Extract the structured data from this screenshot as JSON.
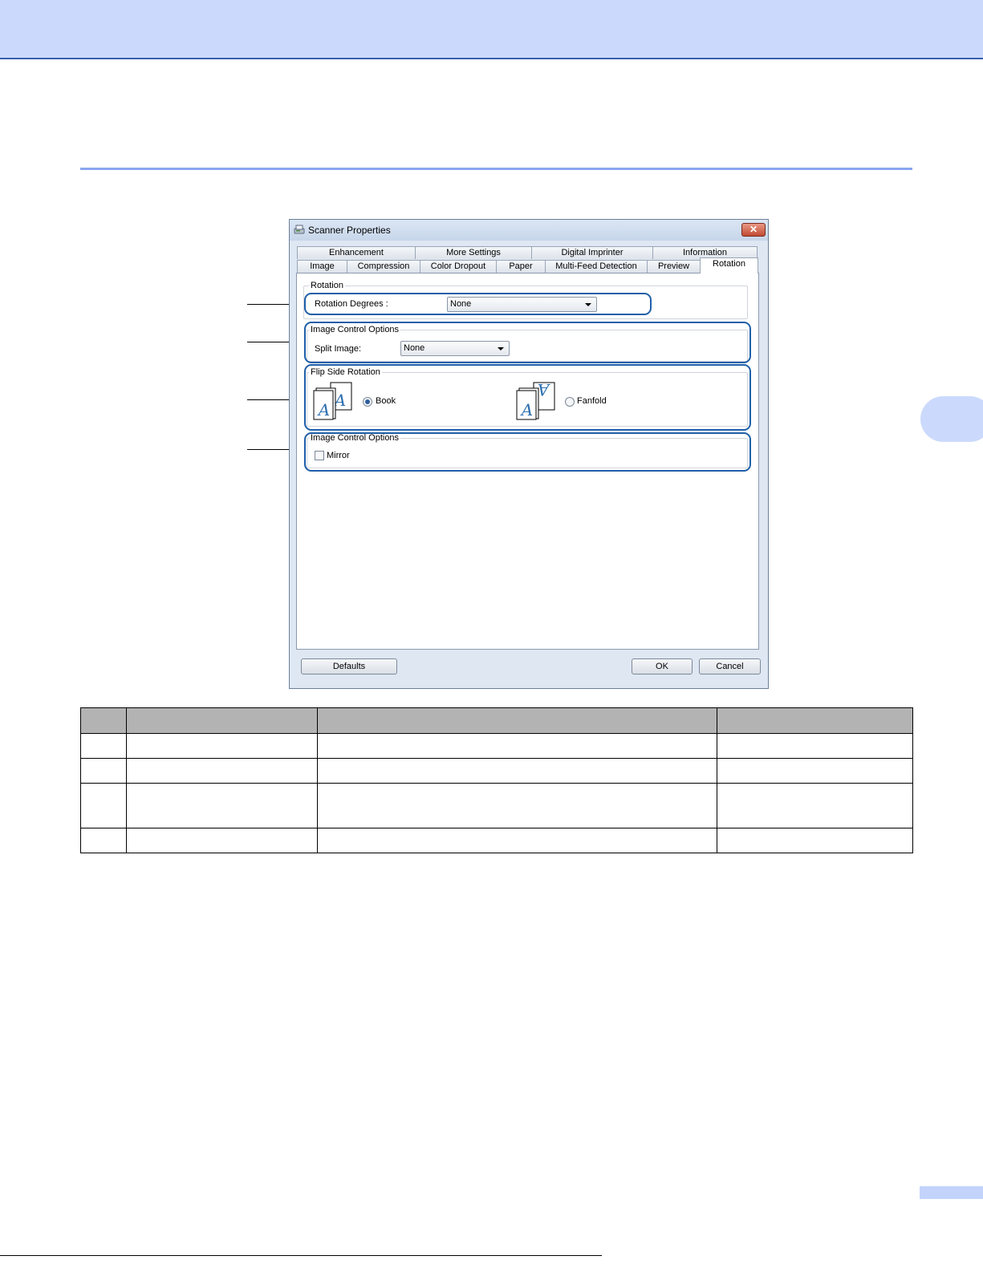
{
  "dialog": {
    "title": "Scanner Properties",
    "close_label": "✕",
    "tabs_row1": [
      "Enhancement",
      "More Settings",
      "Digital Imprinter",
      "Information"
    ],
    "tabs_row2": [
      "Image",
      "Compression",
      "Color Dropout",
      "Paper",
      "Multi-Feed Detection",
      "Preview",
      "Rotation"
    ],
    "active_tab": "Rotation",
    "rotation_group": {
      "legend": "Rotation",
      "degrees_label": "Rotation Degrees :",
      "degrees_value": "None"
    },
    "image_control_group": {
      "legend": "Image Control Options",
      "split_label": "Split Image:",
      "split_value": "None"
    },
    "flip_group": {
      "legend": "Flip Side Rotation",
      "book_label": "Book",
      "book_selected": true,
      "fanfold_label": "Fanfold",
      "fanfold_selected": false
    },
    "mirror_group": {
      "legend": "Image Control Options",
      "mirror_label": "Mirror",
      "mirror_checked": false
    },
    "buttons": {
      "defaults": "Defaults",
      "ok": "OK",
      "cancel": "Cancel"
    }
  },
  "colors": {
    "highlight": "#1f5fa8",
    "header_band": "#cbdafc",
    "table_header": "#b3b3b3"
  }
}
